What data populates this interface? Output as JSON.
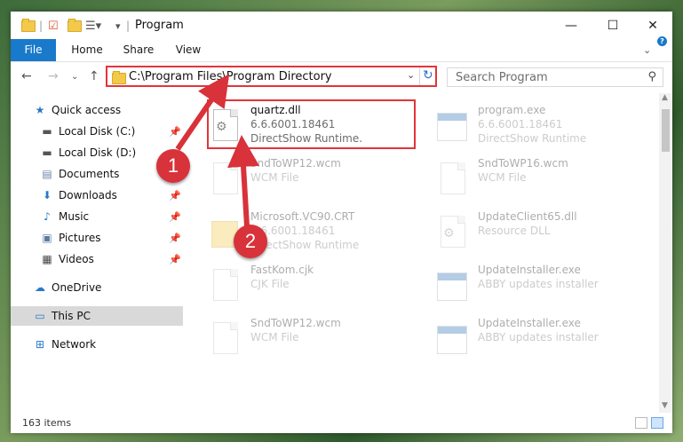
{
  "window": {
    "title": "Program"
  },
  "titlebar": {
    "minimize": "—",
    "maximize": "☐",
    "close": "✕"
  },
  "ribbon": {
    "tabs": [
      "File",
      "Home",
      "Share",
      "View"
    ]
  },
  "address": {
    "path": "C:\\Program Files\\Program Directory"
  },
  "search": {
    "placeholder": "Search Program"
  },
  "sidebar": {
    "items": [
      {
        "label": "Quick access",
        "icon": "star-icon"
      },
      {
        "label": "Local Disk (C:)",
        "icon": "drive-icon",
        "pinned": true
      },
      {
        "label": "Local Disk (D:)",
        "icon": "drive-icon"
      },
      {
        "label": "Documents",
        "icon": "documents-icon",
        "pinned": true
      },
      {
        "label": "Downloads",
        "icon": "download-icon",
        "pinned": true
      },
      {
        "label": "Music",
        "icon": "music-icon",
        "pinned": true
      },
      {
        "label": "Pictures",
        "icon": "pictures-icon",
        "pinned": true
      },
      {
        "label": "Videos",
        "icon": "videos-icon",
        "pinned": true
      },
      {
        "label": "OneDrive",
        "icon": "cloud-icon"
      },
      {
        "label": "This PC",
        "icon": "computer-icon",
        "selected": true
      },
      {
        "label": "Network",
        "icon": "network-icon"
      }
    ]
  },
  "files": [
    {
      "name": "quartz.dll",
      "line1": "6.6.6001.18461",
      "line2": "DirectShow Runtime.",
      "type": "dll",
      "highlighted": true
    },
    {
      "name": "program.exe",
      "line1": "6.6.6001.18461",
      "line2": "DirectShow Runtime",
      "type": "exe"
    },
    {
      "name": "SndToWP12.wcm",
      "line1": "WCM File",
      "line2": "",
      "type": "file"
    },
    {
      "name": "SndToWP16.wcm",
      "line1": "WCM File",
      "line2": "",
      "type": "file"
    },
    {
      "name": "Microsoft.VC90.CRT",
      "line1": "6.6.6001.18461",
      "line2": "DirectShow Runtime",
      "type": "folder"
    },
    {
      "name": "UpdateClient65.dll",
      "line1": "Resource DLL",
      "line2": "",
      "type": "dll"
    },
    {
      "name": "FastKom.cjk",
      "line1": "CJK File",
      "line2": "",
      "type": "file"
    },
    {
      "name": "UpdateInstaller.exe",
      "line1": "ABBY updates installer",
      "line2": "",
      "type": "exe"
    },
    {
      "name": "SndToWP12.wcm",
      "line1": "WCM File",
      "line2": "",
      "type": "file"
    },
    {
      "name": "UpdateInstaller.exe",
      "line1": "ABBY updates installer",
      "line2": "",
      "type": "exe"
    }
  ],
  "status": {
    "count": "163 items"
  },
  "annotations": {
    "step1": "1",
    "step2": "2",
    "color": "#d8323a"
  }
}
